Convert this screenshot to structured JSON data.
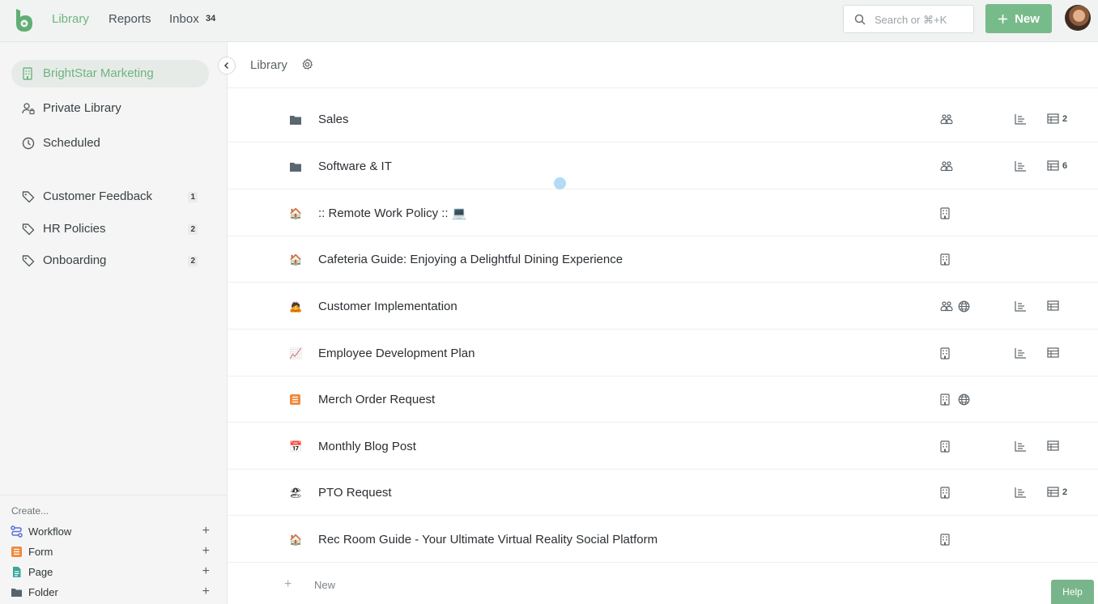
{
  "header": {
    "nav": [
      {
        "label": "Library",
        "active": true
      },
      {
        "label": "Reports",
        "active": false
      },
      {
        "label": "Inbox",
        "active": false
      }
    ],
    "inbox_count": "34",
    "search_placeholder": "Search or ⌘+K",
    "new_button_label": "New"
  },
  "sidebar": {
    "workspaces": [
      {
        "label": "BrightStar Marketing",
        "icon": "building-icon",
        "active": true
      },
      {
        "label": "Private Library",
        "icon": "user-lock-icon",
        "active": false
      },
      {
        "label": "Scheduled",
        "icon": "clock-icon",
        "active": false
      }
    ],
    "tags": [
      {
        "label": "Customer Feedback",
        "count": "1"
      },
      {
        "label": "HR Policies",
        "count": "2"
      },
      {
        "label": "Onboarding",
        "count": "2"
      }
    ],
    "create_label": "Create...",
    "create_items": [
      {
        "label": "Workflow",
        "icon": "workflow-icon",
        "color": "#5b6fd6"
      },
      {
        "label": "Form",
        "icon": "form-icon",
        "color": "#ef8a3c"
      },
      {
        "label": "Page",
        "icon": "page-icon",
        "color": "#39a89a"
      },
      {
        "label": "Folder",
        "icon": "folder-icon",
        "color": "#55636e"
      }
    ]
  },
  "main": {
    "breadcrumb": "Library",
    "rows": [
      {
        "title": "Sales",
        "icon": "folder",
        "meta1": "group",
        "meta2": "",
        "report": true,
        "table": true,
        "table_count": "2"
      },
      {
        "title": "Software & IT",
        "icon": "folder",
        "meta1": "group",
        "meta2": "",
        "report": true,
        "table": true,
        "table_count": "6"
      },
      {
        "title": ":: Remote Work Policy :: 💻",
        "icon": "🏠",
        "meta1": "building",
        "meta2": "",
        "report": false,
        "table": false,
        "table_count": ""
      },
      {
        "title": "Cafeteria Guide: Enjoying a Delightful Dining Experience",
        "icon": "🏠",
        "meta1": "building",
        "meta2": "",
        "report": false,
        "table": false,
        "table_count": ""
      },
      {
        "title": "Customer Implementation",
        "icon": "🙇",
        "meta1": "group",
        "meta2": "globe",
        "report": true,
        "table": true,
        "table_count": ""
      },
      {
        "title": "Employee Development Plan",
        "icon": "📈",
        "meta1": "building",
        "meta2": "",
        "report": true,
        "table": true,
        "table_count": ""
      },
      {
        "title": "Merch Order Request",
        "icon": "form",
        "meta1": "building",
        "meta2": "globe",
        "report": false,
        "table": false,
        "table_count": ""
      },
      {
        "title": "Monthly Blog Post",
        "icon": "📅",
        "meta1": "building",
        "meta2": "",
        "report": true,
        "table": true,
        "table_count": ""
      },
      {
        "title": "PTO Request",
        "icon": "🏖",
        "meta1": "building",
        "meta2": "",
        "report": true,
        "table": true,
        "table_count": "2"
      },
      {
        "title": "Rec Room Guide - Your Ultimate Virtual Reality Social Platform",
        "icon": "🏠",
        "meta1": "building",
        "meta2": "",
        "report": false,
        "table": false,
        "table_count": ""
      }
    ],
    "add_new_label": "New"
  },
  "help_label": "Help",
  "colors": {
    "accent": "#6fb481",
    "new_button": "#77bb8a",
    "sidebar_bg": "#f4f5f4",
    "topbar_bg": "#f0f3f1"
  }
}
